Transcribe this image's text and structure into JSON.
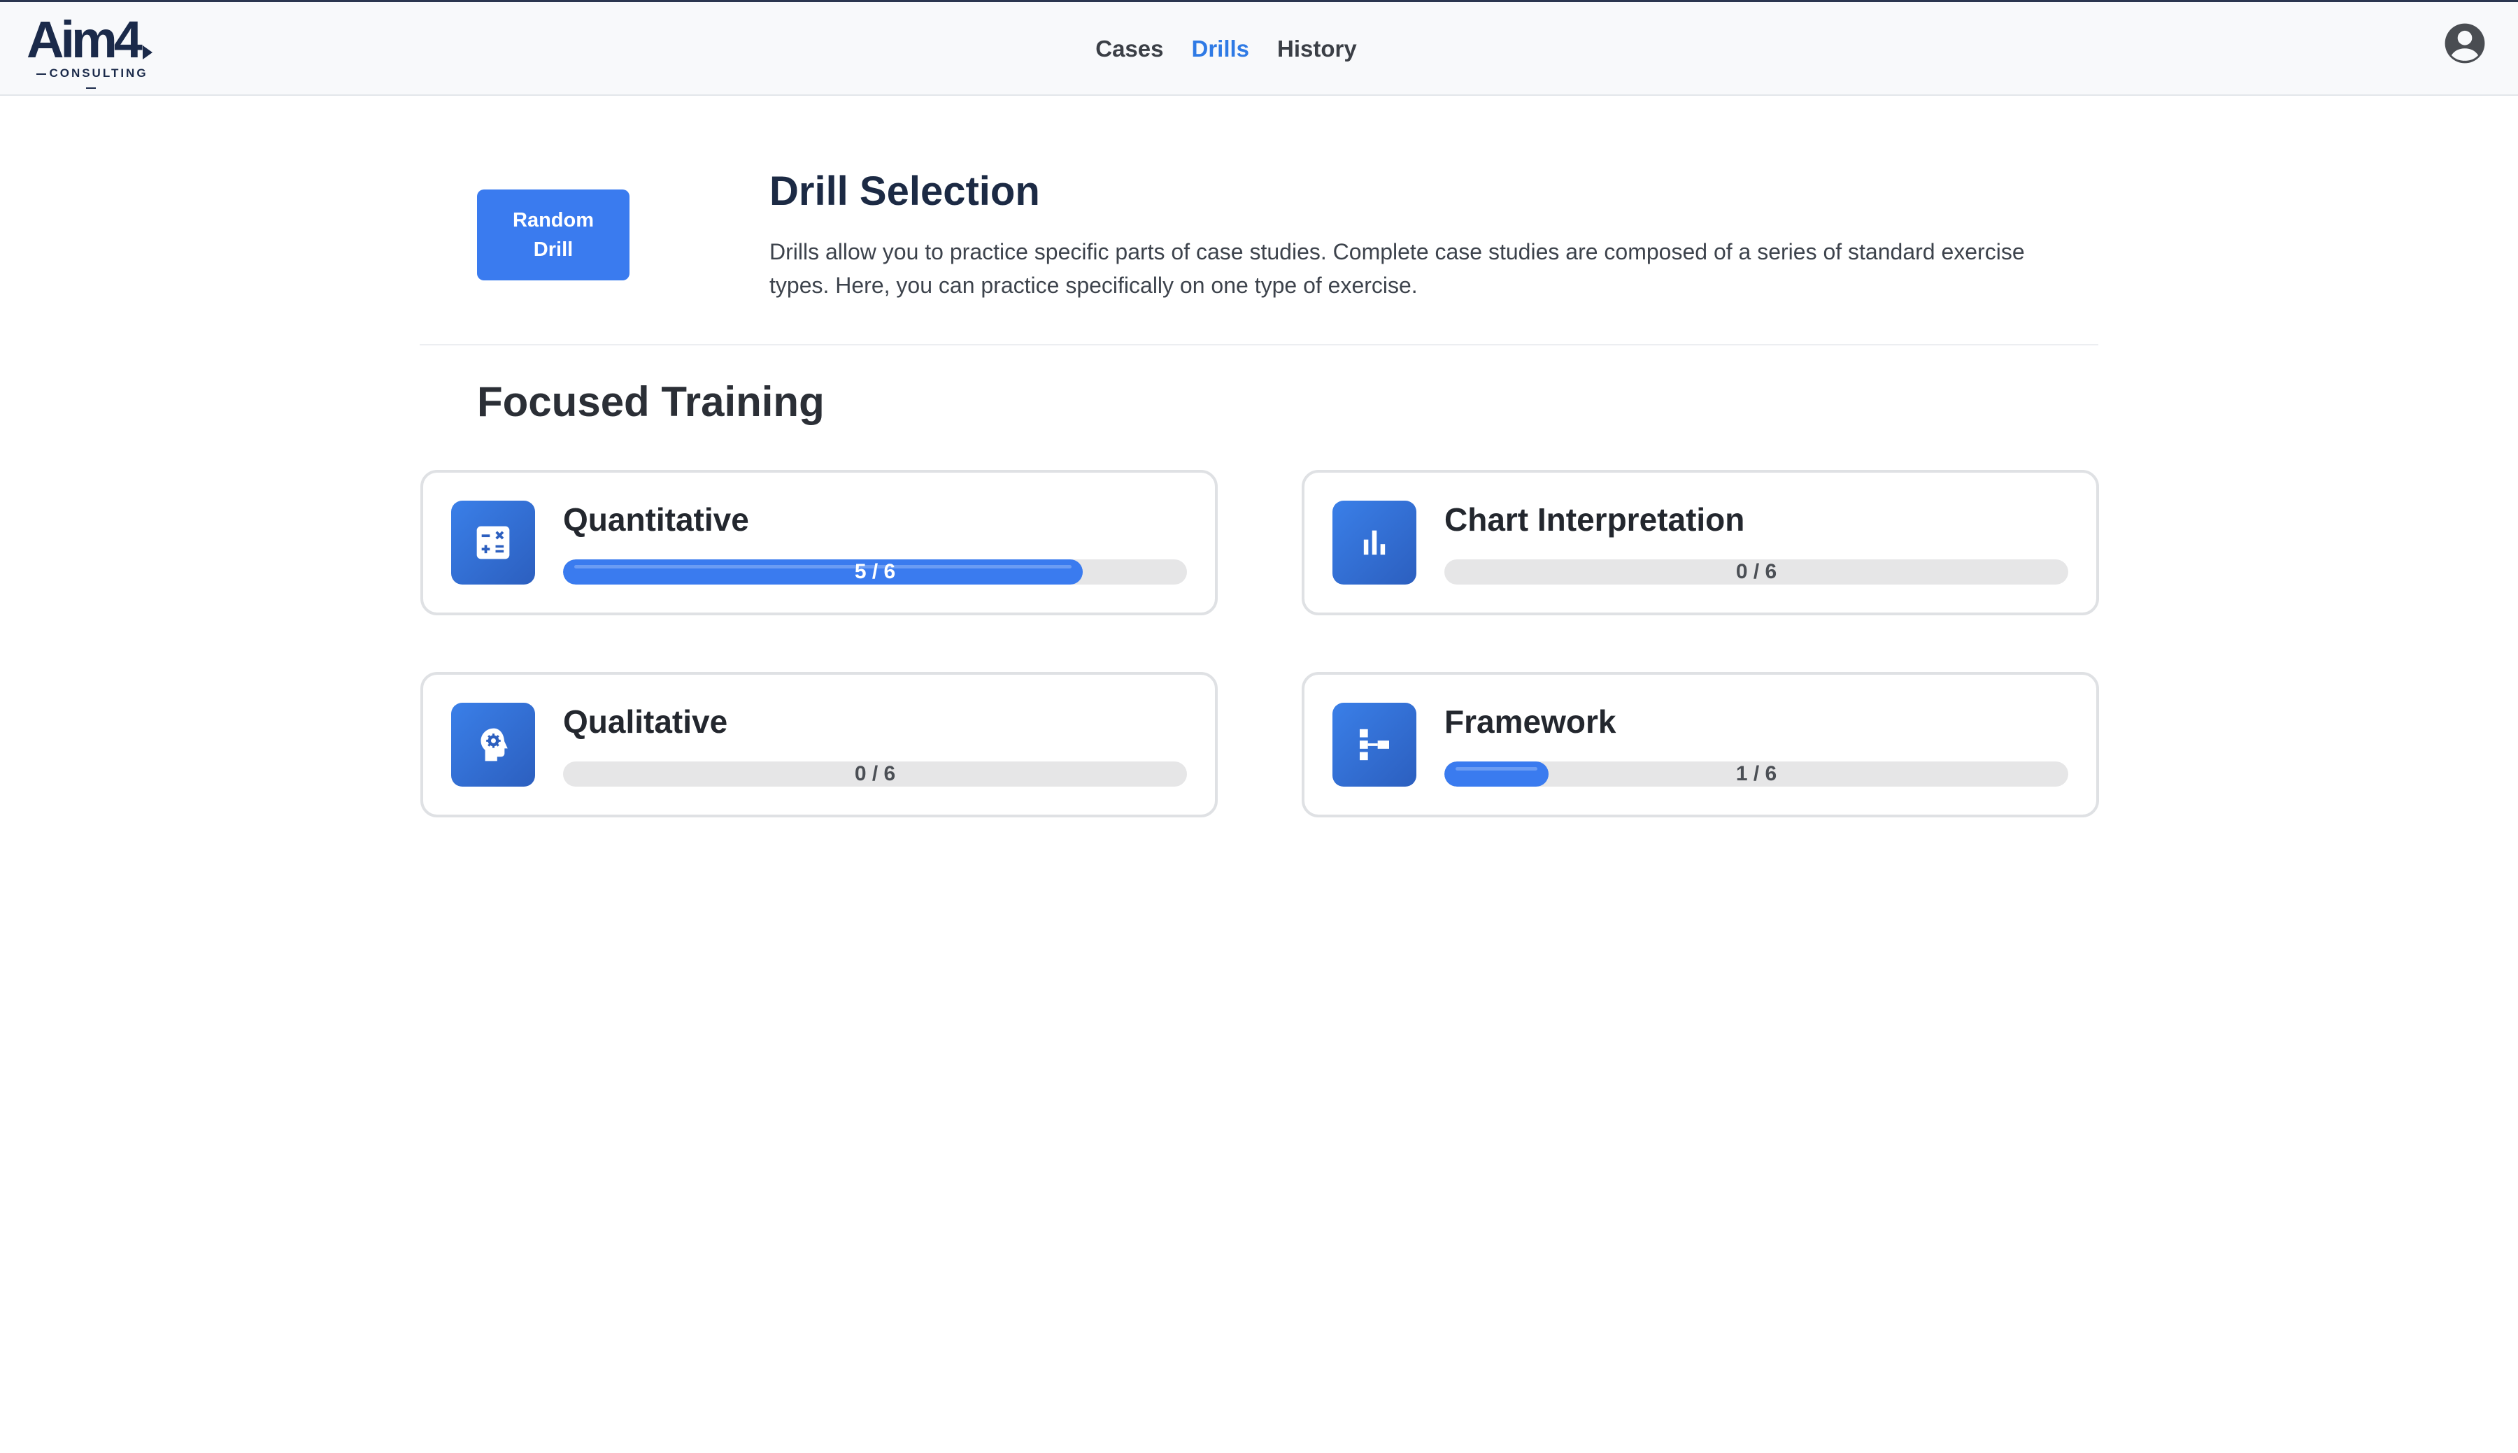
{
  "header": {
    "logo": {
      "word": "Aim4",
      "sub": "CONSULTING"
    },
    "nav": [
      {
        "label": "Cases",
        "active": false
      },
      {
        "label": "Drills",
        "active": true
      },
      {
        "label": "History",
        "active": false
      }
    ],
    "user_icon": "account-circle-icon"
  },
  "intro": {
    "random_button_label": "Random Drill",
    "title": "Drill Selection",
    "description": "Drills allow you to practice specific parts of case studies. Complete case studies are composed of a series of standard exercise types. Here, you can practice specifically on one type of exercise."
  },
  "section_title": "Focused Training",
  "cards": [
    {
      "title": "Quantitative",
      "icon": "calculator-icon",
      "completed": 5,
      "total": 6,
      "label": "5 / 6"
    },
    {
      "title": "Chart Interpretation",
      "icon": "bar-chart-icon",
      "completed": 0,
      "total": 6,
      "label": "0 / 6"
    },
    {
      "title": "Qualitative",
      "icon": "head-gear-icon",
      "completed": 0,
      "total": 6,
      "label": "0 / 6"
    },
    {
      "title": "Framework",
      "icon": "hierarchy-icon",
      "completed": 1,
      "total": 6,
      "label": "1 / 6"
    }
  ],
  "colors": {
    "accent": "#3a7bef",
    "nav_active": "#2f7ae5",
    "track": "#e6e6e7"
  }
}
